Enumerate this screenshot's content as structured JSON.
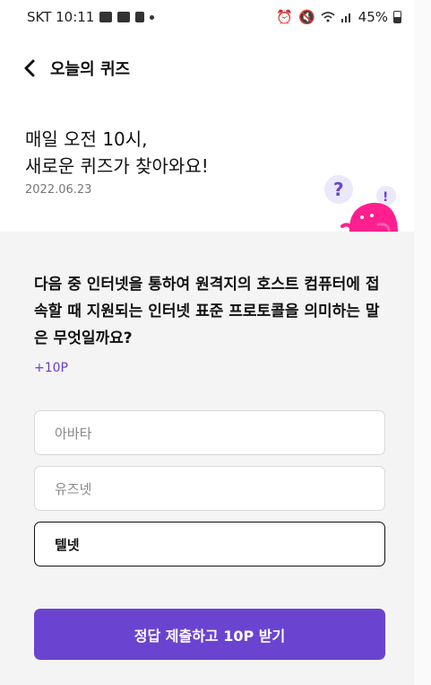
{
  "status_bar": {
    "carrier_time": "SKT 10:11",
    "battery": "45%",
    "icons": [
      "gallery-icon",
      "no-photo-icon",
      "edit-icon",
      "dot-icon",
      "alarm-icon",
      "mute-icon",
      "wifi-icon",
      "signal-icon",
      "battery-icon"
    ]
  },
  "header": {
    "title": "오늘의 퀴즈",
    "back_icon": "chevron-left-icon"
  },
  "hero": {
    "headline": "매일 오전 10시,\n새로운 퀴즈가 찾아와요!",
    "date": "2022.06.23",
    "mascot_question_mark": "?",
    "mascot_exclamation": "!"
  },
  "quiz": {
    "question": "다음 중 인터넷을 통하여 원격지의 호스트 컴퓨터에 접속할 때 지원되는 인터넷 표준 프로토콜을 의미하는 말은 무엇일까요?",
    "points": "+10P",
    "options": [
      {
        "label": "아바타",
        "selected": false
      },
      {
        "label": "유즈넷",
        "selected": false
      },
      {
        "label": "텔넷",
        "selected": true
      }
    ],
    "submit_label": "정답 제출하고 10P 받기"
  },
  "colors": {
    "accent": "#6a44d0",
    "mascot_pink": "#ff1f8e",
    "background_gray": "#f4f4f4"
  }
}
